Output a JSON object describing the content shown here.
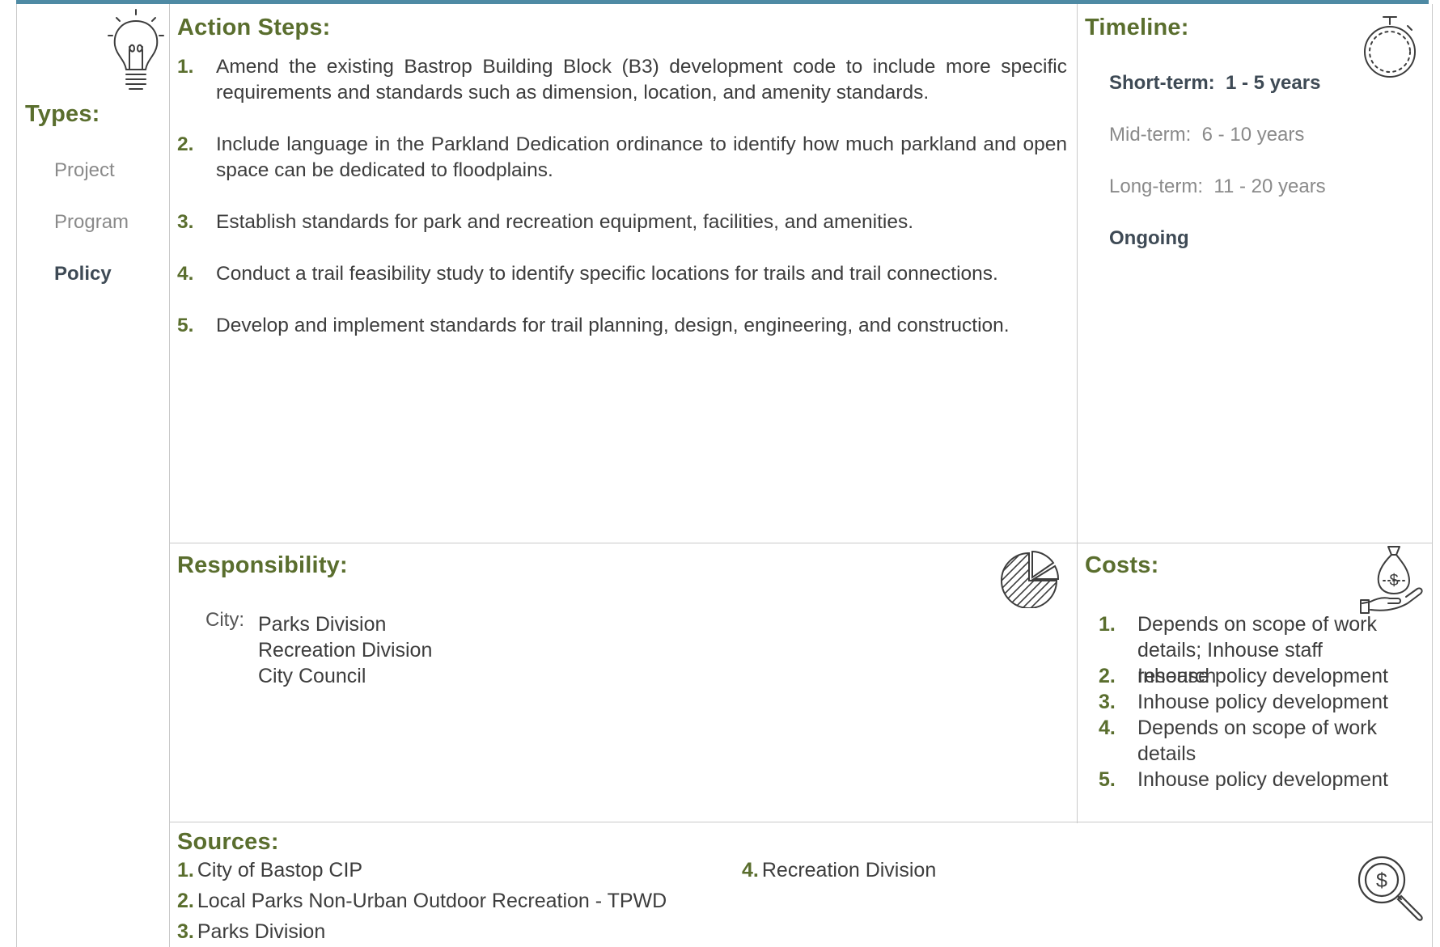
{
  "colors": {
    "accent_bar": "#4e8aa4",
    "heading": "#5a6e2e",
    "active_text": "#3e4a55",
    "muted_text": "#8a8a8a",
    "body_text": "#3d3d3d"
  },
  "types": {
    "heading": "Types:",
    "items": [
      {
        "label": "Project",
        "active": false
      },
      {
        "label": "Program",
        "active": false
      },
      {
        "label": "Policy",
        "active": true
      }
    ],
    "icon": "lightbulb-icon"
  },
  "action_steps": {
    "heading": "Action Steps:",
    "items": [
      {
        "num": "1.",
        "text": "Amend the existing Bastrop Building Block (B3) development code to include more specific requirements and standards such as dimension, location, and amenity standards."
      },
      {
        "num": "2.",
        "text": "Include language in the Parkland Dedication ordinance to identify how much parkland and open space can be dedicated to floodplains."
      },
      {
        "num": "3.",
        "text": "Establish standards for park and recreation equipment, facilities, and amenities."
      },
      {
        "num": "4.",
        "text": "Conduct a trail feasibility study to identify specific locations for trails and trail connections."
      },
      {
        "num": "5.",
        "text": "Develop and implement standards for trail planning, design, engineering, and construction."
      }
    ]
  },
  "timeline": {
    "heading": "Timeline:",
    "icon": "stopwatch-icon",
    "items": [
      {
        "label": "Short-term:  1 - 5 years",
        "active": true
      },
      {
        "label": "Mid-term:  6 - 10 years",
        "active": false
      },
      {
        "label": "Long-term:  11 - 20 years",
        "active": false
      },
      {
        "label": "Ongoing",
        "active": true
      }
    ]
  },
  "responsibility": {
    "heading": "Responsibility:",
    "icon": "pie-chart-icon",
    "label": "City:",
    "lines": [
      "Parks Division",
      "Recreation Division",
      "City Council"
    ]
  },
  "costs": {
    "heading": "Costs:",
    "icon": "money-bag-hand-icon",
    "items": [
      {
        "num": "1.",
        "text": "Depends on scope of work details; Inhouse staff research"
      },
      {
        "num": "2.",
        "text": "Inhouse policy development"
      },
      {
        "num": "3.",
        "text": "Inhouse policy development"
      },
      {
        "num": "4.",
        "text": "Depends on scope of work details"
      },
      {
        "num": "5.",
        "text": "Inhouse policy development"
      }
    ]
  },
  "sources": {
    "heading": "Sources:",
    "icon": "magnifier-dollar-icon",
    "items": [
      {
        "num": "1.",
        "text": "City of Bastop CIP"
      },
      {
        "num": "2.",
        "text": "Local Parks Non-Urban Outdoor Recreation - TPWD"
      },
      {
        "num": "3.",
        "text": "Parks Division"
      },
      {
        "num": "4.",
        "text": "Recreation Division"
      }
    ]
  }
}
